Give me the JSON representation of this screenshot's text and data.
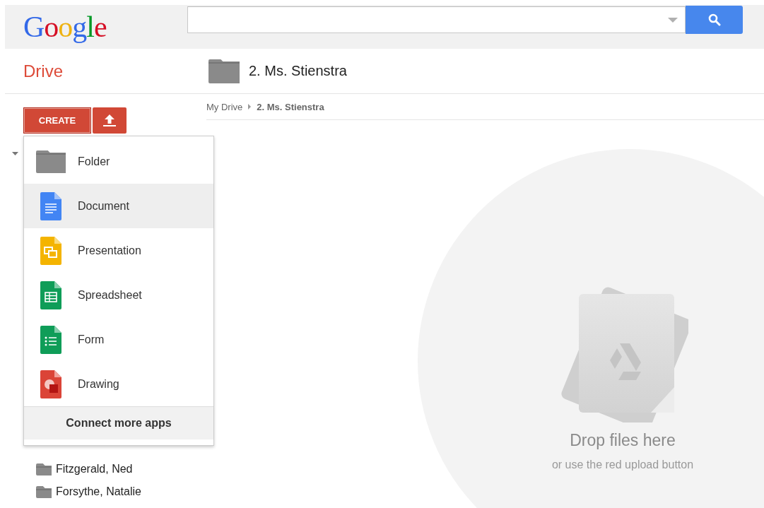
{
  "header": {
    "logo": "Google"
  },
  "app": {
    "name": "Drive"
  },
  "folder": {
    "title": "2. Ms. Stienstra"
  },
  "breadcrumb": [
    {
      "label": "My Drive",
      "current": false
    },
    {
      "label": "2. Ms. Stienstra",
      "current": true
    }
  ],
  "create_button": "CREATE",
  "create_menu": {
    "items": [
      {
        "kind": "folder",
        "label": "Folder",
        "selected": false
      },
      {
        "kind": "document",
        "label": "Document",
        "selected": true
      },
      {
        "kind": "presentation",
        "label": "Presentation",
        "selected": false
      },
      {
        "kind": "spreadsheet",
        "label": "Spreadsheet",
        "selected": false
      },
      {
        "kind": "form",
        "label": "Form",
        "selected": false
      },
      {
        "kind": "drawing",
        "label": "Drawing",
        "selected": false
      }
    ],
    "footer": "Connect more apps"
  },
  "sidebar": {
    "folders": [
      {
        "label": "Fitzgerald, Ned"
      },
      {
        "label": "Forsythe, Natalie"
      }
    ]
  },
  "drop_zone": {
    "title": "Drop files here",
    "hint": "or use the red upload button"
  }
}
